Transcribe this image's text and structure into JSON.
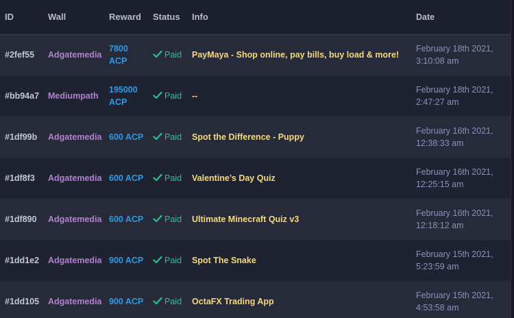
{
  "headers": {
    "id": "ID",
    "wall": "Wall",
    "reward": "Reward",
    "status": "Status",
    "info": "Info",
    "date": "Date"
  },
  "rows": [
    {
      "id": "#2fef55",
      "wall": "Adgatemedia",
      "reward_amount": "7800",
      "reward_unit": "ACP",
      "status": "Paid",
      "info": "PayMaya - Shop online, pay bills, buy load & more!",
      "date_line1": "February 18th 2021,",
      "date_line2": "3:10:08 am"
    },
    {
      "id": "#bb94a7",
      "wall": "Mediumpath",
      "reward_amount": "195000",
      "reward_unit": "ACP",
      "status": "Paid",
      "info": "--",
      "date_line1": "February 18th 2021,",
      "date_line2": "2:47:27 am"
    },
    {
      "id": "#1df99b",
      "wall": "Adgatemedia",
      "reward_amount": "600",
      "reward_unit": "ACP",
      "status": "Paid",
      "info": "Spot the Difference - Puppy",
      "date_line1": "February 16th 2021,",
      "date_line2": "12:38:33 am"
    },
    {
      "id": "#1df8f3",
      "wall": "Adgatemedia",
      "reward_amount": "600",
      "reward_unit": "ACP",
      "status": "Paid",
      "info": "Valentine’s Day Quiz",
      "date_line1": "February 16th 2021,",
      "date_line2": "12:25:15 am"
    },
    {
      "id": "#1df890",
      "wall": "Adgatemedia",
      "reward_amount": "600",
      "reward_unit": "ACP",
      "status": "Paid",
      "info": "Ultimate Minecraft Quiz v3",
      "date_line1": "February 16th 2021,",
      "date_line2": "12:18:12 am"
    },
    {
      "id": "#1dd1e2",
      "wall": "Adgatemedia",
      "reward_amount": "900",
      "reward_unit": "ACP",
      "status": "Paid",
      "info": "Spot The Snake",
      "date_line1": "February 15th 2021,",
      "date_line2": "5:23:59 am"
    },
    {
      "id": "#1dd105",
      "wall": "Adgatemedia",
      "reward_amount": "900",
      "reward_unit": "ACP",
      "status": "Paid",
      "info": "OctaFX Trading App",
      "date_line1": "February 15th 2021,",
      "date_line2": "4:53:58 am"
    }
  ],
  "colors": {
    "background": "#1b1e2b",
    "wall": "#b181d0",
    "reward": "#2f9ae3",
    "status_paid": "#27c1a3",
    "info": "#f5d97a",
    "date": "#8a93b6"
  },
  "icons": {
    "status": "check-icon"
  }
}
